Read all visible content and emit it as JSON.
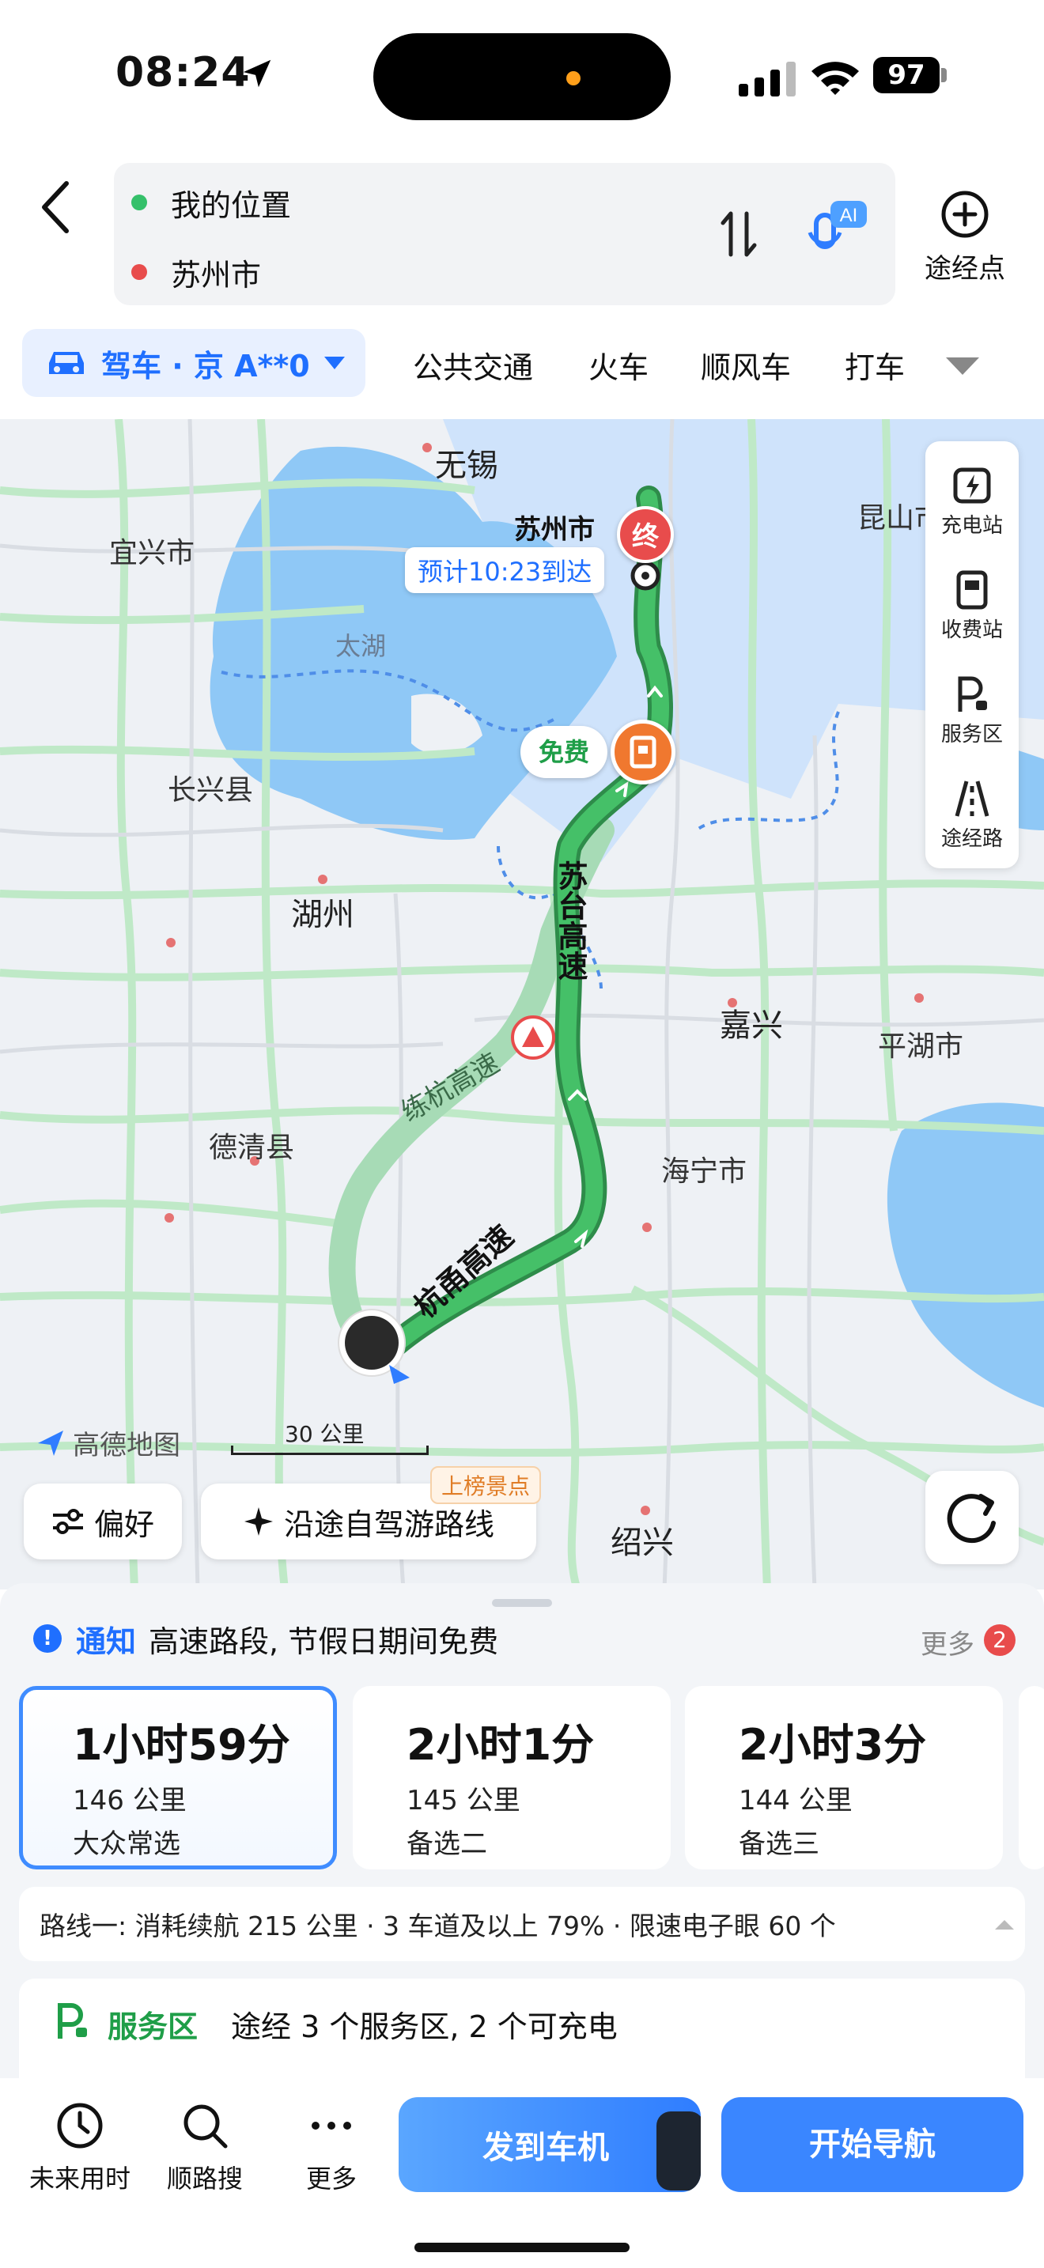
{
  "status_bar": {
    "time": "08:24",
    "battery": "97"
  },
  "route": {
    "origin": "我的位置",
    "destination": "苏州市",
    "waypoint_label": "途经点",
    "ai_badge": "AI"
  },
  "modes": {
    "active": "驾车 · 京 A**0",
    "tabs": [
      "公共交通",
      "火车",
      "顺风车",
      "打车"
    ]
  },
  "map": {
    "places": {
      "wuxi": "无锡",
      "yixing": "宜兴市",
      "suzhou": "苏州市",
      "kunshan": "昆山市",
      "taihu": "太湖",
      "changxing": "长兴县",
      "huzhou": "湖州",
      "jiaxing": "嘉兴",
      "pinghu": "平湖市",
      "deqing": "德清县",
      "haining": "海宁市",
      "shaoxing": "绍兴"
    },
    "roads": {
      "sutai": "苏台高速",
      "lianhang": "练杭高速",
      "hangyong": "杭甬高速"
    },
    "eta": "预计10:23到达",
    "end_marker": "终",
    "free_tag": "免费",
    "side_panel": [
      "充电站",
      "收费站",
      "服务区",
      "途经路"
    ],
    "brand": "高德地图",
    "scale": "30 公里",
    "preference_label": "偏好",
    "selfdrive_label": "沿途自驾游路线",
    "hot_tag": "上榜景点"
  },
  "sheet": {
    "notice_tag": "通知",
    "notice_text": "高速路段, 节假日期间免费",
    "more_label": "更多",
    "more_count": "2",
    "routes": [
      {
        "time": "1小时59分",
        "distance": "146 公里",
        "tag": "大众常选"
      },
      {
        "time": "2小时1分",
        "distance": "145 公里",
        "tag": "备选二"
      },
      {
        "time": "2小时3分",
        "distance": "144 公里",
        "tag": "备选三"
      }
    ],
    "detail": "路线一: 消耗续航 215 公里 · 3 车道及以上 79% · 限速电子眼 60 个",
    "service_tag": "服务区",
    "service_text": "途经 3 个服务区, 2 个可充电"
  },
  "bottom_bar": {
    "items": [
      "未来用时",
      "顺路搜",
      "更多"
    ],
    "send_label": "发到车机",
    "navigate_label": "开始导航"
  },
  "colors": {
    "accent": "#1f6fff",
    "route": "#3dbb62",
    "end": "#e84c4c",
    "toll": "#f0782f"
  }
}
